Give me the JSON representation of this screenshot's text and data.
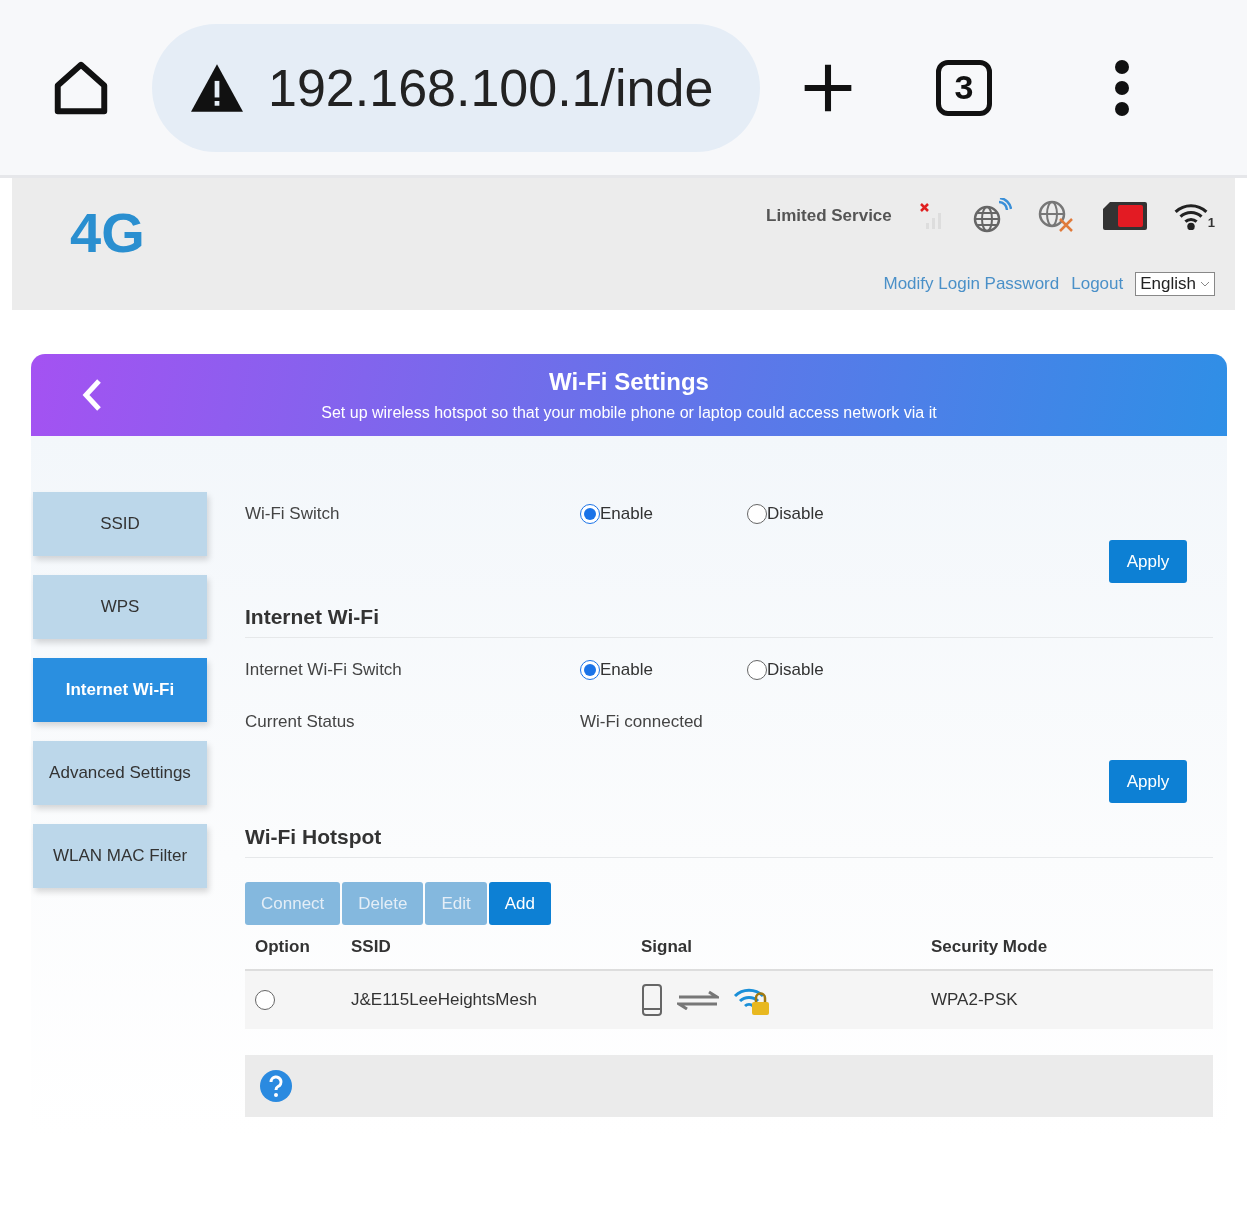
{
  "browser": {
    "url": "192.168.100.1/inde",
    "tab_count": "3"
  },
  "header": {
    "logo": "4G",
    "status": "Limited Service",
    "wifi_clients": "1",
    "links": [
      "Modify Login Password",
      "Logout"
    ],
    "language": "English"
  },
  "page": {
    "title": "Wi-Fi Settings",
    "subtitle": "Set up wireless hotspot so that your mobile phone or laptop could access network via it"
  },
  "sidebar": [
    {
      "label": "SSID",
      "selected": false
    },
    {
      "label": "WPS",
      "selected": false
    },
    {
      "label": "Internet Wi-Fi",
      "selected": true
    },
    {
      "label": "Advanced Settings",
      "selected": false
    },
    {
      "label": "WLAN MAC Filter",
      "selected": false
    }
  ],
  "wifi_switch": {
    "label": "Wi-Fi Switch",
    "options": [
      {
        "label": "Enable",
        "selected": true
      },
      {
        "label": "Disable",
        "selected": false
      }
    ],
    "apply": "Apply"
  },
  "internet_wifi": {
    "heading": "Internet Wi-Fi",
    "switch_label": "Internet Wi-Fi Switch",
    "options": [
      {
        "label": "Enable",
        "selected": true
      },
      {
        "label": "Disable",
        "selected": false
      }
    ],
    "status_label": "Current Status",
    "status_value": "Wi-Fi connected",
    "apply": "Apply"
  },
  "hotspot": {
    "heading": "Wi-Fi Hotspot",
    "buttons": [
      {
        "label": "Connect",
        "disabled": true
      },
      {
        "label": "Delete",
        "disabled": true
      },
      {
        "label": "Edit",
        "disabled": true
      },
      {
        "label": "Add",
        "disabled": false
      }
    ],
    "columns": [
      "Option",
      "SSID",
      "Signal",
      "Security Mode"
    ],
    "rows": [
      {
        "selected": false,
        "ssid": "J&E115LeeHeightsMesh",
        "security": "WPA2-PSK"
      }
    ]
  }
}
